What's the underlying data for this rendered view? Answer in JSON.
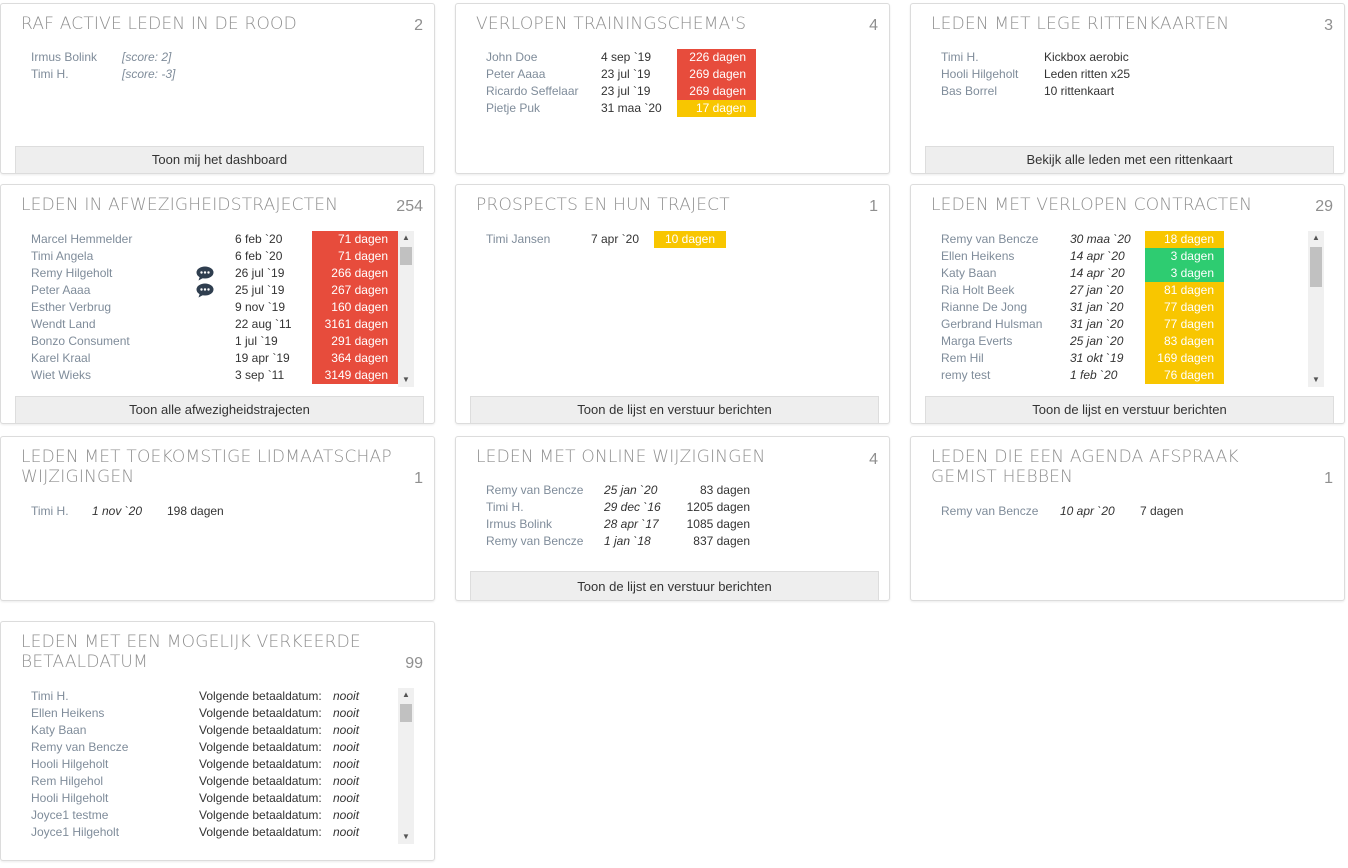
{
  "raf": {
    "title": "RAF ACTIVE LEDEN IN DE ROOD",
    "count": "2",
    "rows": [
      {
        "name": "Irmus Bolink",
        "score": "[score: 2]"
      },
      {
        "name": "Timi H.",
        "score": "[score: -3]"
      }
    ],
    "button": "Toon mij het dashboard"
  },
  "training": {
    "title": "VERLOPEN TRAININGSCHEMA'S",
    "count": "4",
    "rows": [
      {
        "name": "John Doe",
        "date": "4 sep `19",
        "days": "226 dagen",
        "status": "red"
      },
      {
        "name": "Peter Aaaa",
        "date": "23 jul `19",
        "days": "269 dagen",
        "status": "red"
      },
      {
        "name": "Ricardo Seffelaar",
        "date": "23 jul `19",
        "days": "269 dagen",
        "status": "red"
      },
      {
        "name": "Pietje Puk",
        "date": "31 maa `20",
        "days": "17 dagen",
        "status": "yellow"
      }
    ]
  },
  "rittenkaart": {
    "title": "LEDEN MET LEGE RITTENKAARTEN",
    "count": "3",
    "rows": [
      {
        "name": "Timi H.",
        "card": "Kickbox aerobic"
      },
      {
        "name": "Hooli Hilgeholt",
        "card": "Leden ritten x25"
      },
      {
        "name": "Bas Borrel",
        "card": "10 rittenkaart"
      }
    ],
    "button": "Bekijk alle leden met een rittenkaart"
  },
  "afwezig": {
    "title": "LEDEN IN AFWEZIGHEIDSTRAJECTEN",
    "count": "254",
    "rows": [
      {
        "name": "Marcel Hemmelder",
        "date": "6 feb `20",
        "days": "71 dagen",
        "chat": false
      },
      {
        "name": "Timi Angela",
        "date": "6 feb `20",
        "days": "71 dagen",
        "chat": false
      },
      {
        "name": "Remy Hilgeholt",
        "date": "26 jul `19",
        "days": "266 dagen",
        "chat": true
      },
      {
        "name": "Peter Aaaa",
        "date": "25 jul `19",
        "days": "267 dagen",
        "chat": true
      },
      {
        "name": "Esther Verbrug",
        "date": "9 nov `19",
        "days": "160 dagen",
        "chat": false
      },
      {
        "name": "Wendt Land",
        "date": "22 aug `11",
        "days": "3161 dagen",
        "chat": false
      },
      {
        "name": "Bonzo Consument",
        "date": "1 jul `19",
        "days": "291 dagen",
        "chat": false
      },
      {
        "name": "Karel Kraal",
        "date": "19 apr `19",
        "days": "364 dagen",
        "chat": false
      },
      {
        "name": "Wiet Wieks",
        "date": "3 sep `11",
        "days": "3149 dagen",
        "chat": false
      }
    ],
    "button": "Toon alle afwezigheidstrajecten"
  },
  "prospects": {
    "title": "PROSPECTS EN HUN TRAJECT",
    "count": "1",
    "rows": [
      {
        "name": "Timi Jansen",
        "date": "7 apr `20",
        "days": "10 dagen"
      }
    ],
    "button": "Toon de lijst en verstuur berichten"
  },
  "contracten": {
    "title": "LEDEN MET VERLOPEN CONTRACTEN",
    "count": "29",
    "rows": [
      {
        "name": "Remy van Bencze",
        "date": "30 maa `20",
        "days": "18 dagen",
        "status": "yellow"
      },
      {
        "name": "Ellen Heikens",
        "date": "14 apr `20",
        "days": "3 dagen",
        "status": "green"
      },
      {
        "name": "Katy Baan",
        "date": "14 apr `20",
        "days": "3 dagen",
        "status": "green"
      },
      {
        "name": "Ria Holt Beek",
        "date": "27 jan `20",
        "days": "81 dagen",
        "status": "yellow"
      },
      {
        "name": "Rianne De Jong",
        "date": "31 jan `20",
        "days": "77 dagen",
        "status": "yellow"
      },
      {
        "name": "Gerbrand Hulsman",
        "date": "31 jan `20",
        "days": "77 dagen",
        "status": "yellow"
      },
      {
        "name": "Marga Everts",
        "date": "25 jan `20",
        "days": "83 dagen",
        "status": "yellow"
      },
      {
        "name": "Rem Hil",
        "date": "31 okt `19",
        "days": "169 dagen",
        "status": "yellow"
      },
      {
        "name": "remy test",
        "date": "1 feb `20",
        "days": "76 dagen",
        "status": "yellow"
      }
    ],
    "button": "Toon de lijst en verstuur berichten"
  },
  "toekomstig": {
    "title": "LEDEN MET TOEKOMSTIGE LIDMAATSCHAP WIJZIGINGEN",
    "count": "1",
    "rows": [
      {
        "name": "Timi H.",
        "date": "1 nov `20",
        "days": "198 dagen"
      }
    ]
  },
  "online": {
    "title": "LEDEN MET ONLINE WIJZIGINGEN",
    "count": "4",
    "rows": [
      {
        "name": "Remy van Bencze",
        "date": "25 jan `20",
        "days": "83 dagen"
      },
      {
        "name": "Timi H.",
        "date": "29 dec `16",
        "days": "1205 dagen"
      },
      {
        "name": "Irmus Bolink",
        "date": "28 apr `17",
        "days": "1085 dagen"
      },
      {
        "name": "Remy van Bencze",
        "date": "1 jan `18",
        "days": "837 dagen"
      }
    ],
    "button": "Toon de lijst en verstuur berichten"
  },
  "agenda": {
    "title": "LEDEN DIE EEN AGENDA AFSPRAAK GEMIST HEBBEN",
    "count": "1",
    "rows": [
      {
        "name": "Remy van Bencze",
        "date": "10 apr `20",
        "days": "7 dagen"
      }
    ]
  },
  "betaal": {
    "title": "LEDEN MET EEN MOGELIJK VERKEERDE BETAALDATUM",
    "count": "99",
    "label": "Volgende betaaldatum:",
    "value": "nooit",
    "rows": [
      {
        "name": "Timi H."
      },
      {
        "name": "Ellen Heikens"
      },
      {
        "name": "Katy Baan"
      },
      {
        "name": "Remy van Bencze"
      },
      {
        "name": "Hooli Hilgeholt"
      },
      {
        "name": "Rem Hilgehol"
      },
      {
        "name": "Hooli Hilgeholt"
      },
      {
        "name": "Joyce1 testme"
      },
      {
        "name": "Joyce1 Hilgeholt"
      }
    ]
  },
  "colors": {
    "red": "#e74c3c",
    "yellow": "#f8c600",
    "green": "#2ecc71",
    "name": "#7f8c9a",
    "title": "#8f8f8f"
  },
  "icons": {
    "chat": "chat-bubble-icon",
    "scroll_up": "scroll-up-arrow-icon",
    "scroll_down": "scroll-down-arrow-icon"
  }
}
